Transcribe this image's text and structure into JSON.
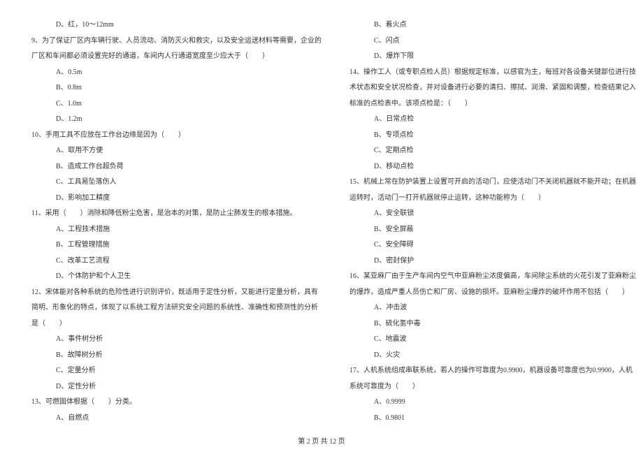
{
  "left_column": [
    {
      "text": "D、红，10～12mm",
      "indent": 2
    },
    {
      "text": "9、为了保证厂区内车辆行驶、人员流动、消防灭火和救灾，以及安全运送材料等需要，企业的",
      "indent": 0
    },
    {
      "text": "厂区和车间都必须设置完好的通道，车间内人行通道宽度至少应大于（　　）",
      "indent": 0
    },
    {
      "text": "A、0.5m",
      "indent": 2
    },
    {
      "text": "B、0.8m",
      "indent": 2
    },
    {
      "text": "C、1.0m",
      "indent": 2
    },
    {
      "text": "D、1.2m",
      "indent": 2
    },
    {
      "text": "10、手用工具不应放在工作台边缘是因为（　　）",
      "indent": 0
    },
    {
      "text": "A、取用不方便",
      "indent": 2
    },
    {
      "text": "B、造成工作台超负荷",
      "indent": 2
    },
    {
      "text": "C、工具易坠落伤人",
      "indent": 2
    },
    {
      "text": "D、影响加工精度",
      "indent": 2
    },
    {
      "text": "11、采用（　　）消除和降低粉尘危害，是治本的对策，是防止尘肺发生的根本措施。",
      "indent": 0
    },
    {
      "text": "A、工程技术措施",
      "indent": 2
    },
    {
      "text": "B、工程管理措施",
      "indent": 2
    },
    {
      "text": "C、改革工艺流程",
      "indent": 2
    },
    {
      "text": "D、个体防护和个人卫生",
      "indent": 2
    },
    {
      "text": "12、宋体能对各种系统的危险性进行识别评价，既适用于定性分析，又能进行定量分析，具有",
      "indent": 0
    },
    {
      "text": "简明、形象化的特点，体现了以系统工程方法研究安全问题的系统性、准确性和预测性的分析",
      "indent": 0
    },
    {
      "text": "是（　　）",
      "indent": 0
    },
    {
      "text": "A、事件树分析",
      "indent": 2
    },
    {
      "text": "B、故障树分析",
      "indent": 2
    },
    {
      "text": "C、定量分析",
      "indent": 2
    },
    {
      "text": "D、定性分析",
      "indent": 2
    },
    {
      "text": "13、可燃固体根据（　　）分类。",
      "indent": 0
    },
    {
      "text": "A、自燃点",
      "indent": 2
    }
  ],
  "right_column": [
    {
      "text": "B、着火点",
      "indent": 2
    },
    {
      "text": "C、闪点",
      "indent": 2
    },
    {
      "text": "D、爆炸下限",
      "indent": 2
    },
    {
      "text": "14、操作工人（或专职点检人员）根据规定标准，以感官为主，每班对各设备关键部位进行技",
      "indent": 0
    },
    {
      "text": "术状态和安全状况检查，并对设备进行必要的清扫、擦拭、润滑、紧固和调整，检查结果记入",
      "indent": 0
    },
    {
      "text": "标准的点检表中。该项点检是：（　　）",
      "indent": 0
    },
    {
      "text": "A、日常点检",
      "indent": 2
    },
    {
      "text": "B、专项点检",
      "indent": 2
    },
    {
      "text": "C、定期点检",
      "indent": 2
    },
    {
      "text": "D、移动点检",
      "indent": 2
    },
    {
      "text": "15、机械上常在防护装置上设置可开启的活动门，应使活动门不关闭机器就不能开动；在机器",
      "indent": 0
    },
    {
      "text": "运转时，活动门一打开机器就停止运转，这种功能称为（　　）",
      "indent": 0
    },
    {
      "text": "A、安全联锁",
      "indent": 2
    },
    {
      "text": "B、安全屏蔽",
      "indent": 2
    },
    {
      "text": "C、安全障碍",
      "indent": 2
    },
    {
      "text": "D、密封保护",
      "indent": 2
    },
    {
      "text": "16、某亚麻厂由于生产车间内空气中亚麻粉尘浓度偏高，车间除尘系统的火花引发了亚麻粉尘",
      "indent": 0
    },
    {
      "text": "的爆炸，造成严重人员伤亡和厂房、设施的损坏。亚麻粉尘爆炸的破坏作用不包括（　　）",
      "indent": 0
    },
    {
      "text": "A、冲击波",
      "indent": 2
    },
    {
      "text": "B、硫化氢中毒",
      "indent": 2
    },
    {
      "text": "C、地震波",
      "indent": 2
    },
    {
      "text": "D、火灾",
      "indent": 2
    },
    {
      "text": "17、人机系统组成串联系统，若人的操作可靠度为0.9900，机器设备可靠度也为0.9900，人机",
      "indent": 0
    },
    {
      "text": "系统可靠度为（　　）",
      "indent": 0
    },
    {
      "text": "A、0.9999",
      "indent": 2
    },
    {
      "text": "B、0.9801",
      "indent": 2
    }
  ],
  "footer": "第 2 页 共 12 页"
}
